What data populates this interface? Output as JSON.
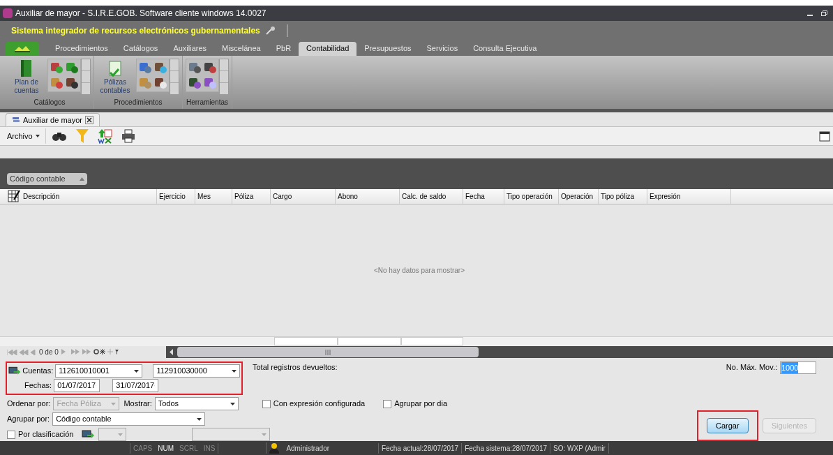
{
  "window": {
    "title": "Auxiliar de mayor - S.I.R.E.GOB. Software cliente windows 14.0027"
  },
  "banner": {
    "text": "Sistema integrador de recursos electrónicos gubernamentales"
  },
  "ribbon_tabs": [
    {
      "label": "Procedimientos",
      "selected": false
    },
    {
      "label": "Catálogos",
      "selected": false
    },
    {
      "label": "Auxiliares",
      "selected": false
    },
    {
      "label": "Miscelánea",
      "selected": false
    },
    {
      "label": "PbR",
      "selected": false
    },
    {
      "label": "Contabilidad",
      "selected": true
    },
    {
      "label": "Presupuestos",
      "selected": false
    },
    {
      "label": "Servicios",
      "selected": false
    },
    {
      "label": "Consulta Ejecutiva",
      "selected": false
    }
  ],
  "ribbon_groups": [
    {
      "label": "Catálogos",
      "large_button": "Plan de cuentas"
    },
    {
      "label": "Procedimientos",
      "large_button": "Pólizas contables"
    },
    {
      "label": "Herramientas"
    }
  ],
  "document_tab": {
    "label": "Auxiliar de mayor"
  },
  "toolbar": {
    "menu": "Archivo"
  },
  "group_panel": {
    "chip": "Código contable"
  },
  "table": {
    "columns": [
      "Descripción",
      "Ejercicio",
      "Mes",
      "Póliza",
      "Cargo",
      "Abono",
      "Calc. de saldo",
      "Fecha",
      "Tipo operación",
      "Operación",
      "Tipo póliza",
      "Expresión"
    ],
    "empty_text": "<No hay datos para mostrar>"
  },
  "pager": {
    "text": "0 de 0"
  },
  "form": {
    "cuentas_label": "Cuentas:",
    "cuenta_desde": "112610010001",
    "cuenta_hasta": "112910030000",
    "fechas_label": "Fechas:",
    "fecha_desde": "01/07/2017",
    "fecha_hasta": "31/07/2017",
    "total_label": "Total registros devueltos:",
    "max_label": "No. Máx. Mov.:",
    "max_value": "1000",
    "ordenar_label": "Ordenar por:",
    "ordenar_value": "Fecha Póliza",
    "ordenar_disabled": true,
    "mostrar_label": "Mostrar:",
    "mostrar_value": "Todos",
    "checks": [
      {
        "label": "Con expresión configurada",
        "checked": false
      },
      {
        "label": "Agrupar por dia",
        "checked": false
      }
    ],
    "agrupar_label": "Agrupar por:",
    "agrupar_value": "Código contable",
    "clasificacion": {
      "label": "Por clasificación",
      "checked": false
    }
  },
  "buttons": [
    {
      "label": "Cargar",
      "disabled": false
    },
    {
      "label": "Siguientes",
      "disabled": true
    }
  ],
  "status_bar": {
    "keys": [
      {
        "label": "CAPS",
        "on": false
      },
      {
        "label": "NUM",
        "on": true
      },
      {
        "label": "SCRL",
        "on": false
      },
      {
        "label": "INS",
        "on": false
      }
    ],
    "user": "Administrador",
    "fecha_actual": "Fecha actual:28/07/2017",
    "fecha_sistema": "Fecha sistema:28/07/2017",
    "so": "SO: WXP (Admir"
  }
}
